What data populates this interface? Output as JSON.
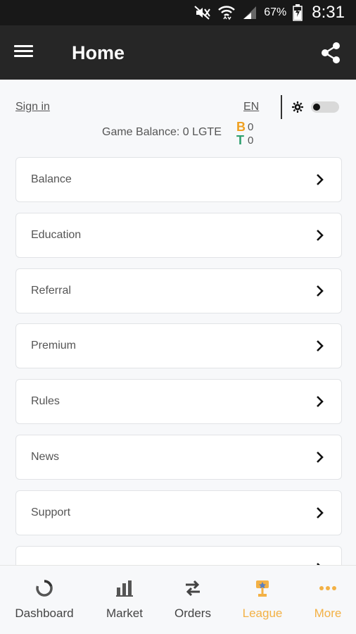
{
  "status_bar": {
    "battery": "67%",
    "time": "8:31",
    "icons": [
      "mute-icon",
      "wifi-icon",
      "signal-icon",
      "battery-icon"
    ]
  },
  "app_bar": {
    "title": "Home",
    "icons": [
      "menu-icon",
      "share-icon"
    ]
  },
  "header": {
    "sign_in": "Sign in",
    "language": "EN",
    "game_balance": "Game Balance: 0 LGTE",
    "btc_symbol": "B",
    "btc_value": "0",
    "usdt_symbol": "T",
    "usdt_value": "0",
    "theme_toggle_on": false
  },
  "menu": {
    "items": [
      {
        "label": "Balance"
      },
      {
        "label": "Education"
      },
      {
        "label": "Referral"
      },
      {
        "label": "Premium"
      },
      {
        "label": "Rules"
      },
      {
        "label": "News"
      },
      {
        "label": "Support"
      },
      {
        "label": ""
      }
    ]
  },
  "bottom_nav": {
    "items": [
      {
        "label": "Dashboard",
        "icon": "dashboard-icon"
      },
      {
        "label": "Market",
        "icon": "market-icon"
      },
      {
        "label": "Orders",
        "icon": "orders-icon"
      },
      {
        "label": "League",
        "icon": "trophy-icon"
      },
      {
        "label": "More",
        "icon": "more-icon"
      }
    ]
  },
  "colors": {
    "app_bar": "#262626",
    "status_bar": "#181818",
    "accent_gold": "#f3b145",
    "btc_orange": "#f0a020",
    "usdt_green": "#30a070"
  }
}
